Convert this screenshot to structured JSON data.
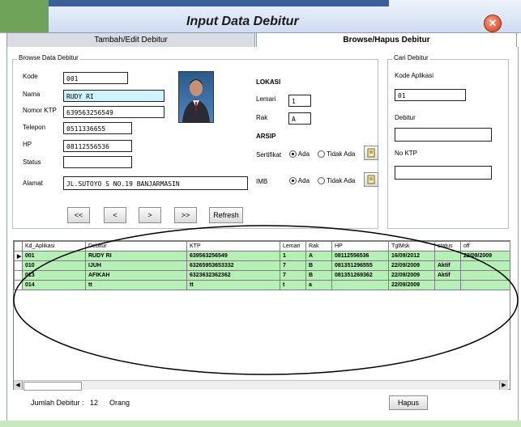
{
  "window": {
    "title": "Input Data Debitur"
  },
  "tabs": [
    {
      "label": "Tambah/Edit Debitur"
    },
    {
      "label": "Browse/Hapus Debitur"
    }
  ],
  "browse": {
    "group_label": "Browse Data Debitur",
    "fields": {
      "kode": {
        "label": "Kode",
        "value": "001"
      },
      "nama": {
        "label": "Nama",
        "value": "RUDY RI"
      },
      "ktp": {
        "label": "Nomor KTP",
        "value": "639563256549"
      },
      "telepon": {
        "label": "Telepon",
        "value": "0511336655"
      },
      "hp": {
        "label": "HP",
        "value": "08112556536"
      },
      "status": {
        "label": "Status",
        "value": ""
      },
      "alamat": {
        "label": "Alamat",
        "value": "JL.SUTOYO S NO.19 BANJARMASIN"
      }
    },
    "lokasi": {
      "header": "LOKASI",
      "lemari_label": "Lemari",
      "lemari_value": "1",
      "rak_label": "Rak",
      "rak_value": "A"
    },
    "arsip": {
      "header": "ARSIP",
      "sertifikat_label": "Sertifikat",
      "imb_label": "IMB",
      "opt_ada": "Ada",
      "opt_tidak": "Tidak Ada"
    },
    "nav": {
      "first": "<<",
      "prev": "<",
      "next": ">",
      "last": ">>",
      "refresh": "Refresh"
    }
  },
  "search": {
    "group_label": "Cari Debitur",
    "kode_label": "Kode Aplikasi",
    "kode_value": "01",
    "debitur_label": "Debitur",
    "debitur_value": "",
    "ktp_label": "No KTP",
    "ktp_value": ""
  },
  "grid": {
    "columns": [
      "Kd_Aplikasi",
      "Debitur",
      "KTP",
      "Lemari",
      "Rak",
      "HP",
      "TglMsk",
      "status",
      "off"
    ],
    "rows": [
      [
        "001",
        "RUDY RI",
        "639563256549",
        "1",
        "A",
        "08112556536",
        "16/09/2012",
        "",
        "22/09/2009"
      ],
      [
        "010",
        "IJUH",
        "63265953653332",
        "7",
        "B",
        "081351296555",
        "22/09/2009",
        "Aktif",
        ""
      ],
      [
        "013",
        "AFIKAH",
        "6323632362362",
        "7",
        "B",
        "081351269362",
        "22/09/2009",
        "Aktif",
        ""
      ],
      [
        "014",
        "tt",
        "tt",
        "t",
        "a",
        "",
        "22/09/2009",
        "",
        ""
      ]
    ]
  },
  "footer": {
    "jumlah_label": "Jumlah Debitur :",
    "jumlah_value": "12",
    "orang": "Orang",
    "hapus": "Hapus"
  }
}
